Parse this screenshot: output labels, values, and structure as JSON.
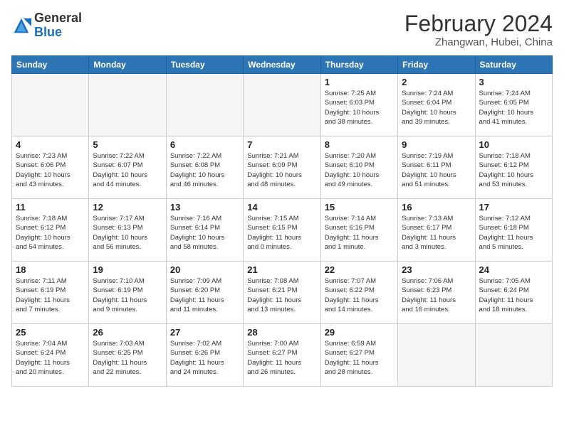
{
  "logo": {
    "general": "General",
    "blue": "Blue"
  },
  "header": {
    "month_year": "February 2024",
    "location": "Zhangwan, Hubei, China"
  },
  "days_of_week": [
    "Sunday",
    "Monday",
    "Tuesday",
    "Wednesday",
    "Thursday",
    "Friday",
    "Saturday"
  ],
  "weeks": [
    [
      {
        "day": "",
        "info": ""
      },
      {
        "day": "",
        "info": ""
      },
      {
        "day": "",
        "info": ""
      },
      {
        "day": "",
        "info": ""
      },
      {
        "day": "1",
        "info": "Sunrise: 7:25 AM\nSunset: 6:03 PM\nDaylight: 10 hours\nand 38 minutes."
      },
      {
        "day": "2",
        "info": "Sunrise: 7:24 AM\nSunset: 6:04 PM\nDaylight: 10 hours\nand 39 minutes."
      },
      {
        "day": "3",
        "info": "Sunrise: 7:24 AM\nSunset: 6:05 PM\nDaylight: 10 hours\nand 41 minutes."
      }
    ],
    [
      {
        "day": "4",
        "info": "Sunrise: 7:23 AM\nSunset: 6:06 PM\nDaylight: 10 hours\nand 43 minutes."
      },
      {
        "day": "5",
        "info": "Sunrise: 7:22 AM\nSunset: 6:07 PM\nDaylight: 10 hours\nand 44 minutes."
      },
      {
        "day": "6",
        "info": "Sunrise: 7:22 AM\nSunset: 6:08 PM\nDaylight: 10 hours\nand 46 minutes."
      },
      {
        "day": "7",
        "info": "Sunrise: 7:21 AM\nSunset: 6:09 PM\nDaylight: 10 hours\nand 48 minutes."
      },
      {
        "day": "8",
        "info": "Sunrise: 7:20 AM\nSunset: 6:10 PM\nDaylight: 10 hours\nand 49 minutes."
      },
      {
        "day": "9",
        "info": "Sunrise: 7:19 AM\nSunset: 6:11 PM\nDaylight: 10 hours\nand 51 minutes."
      },
      {
        "day": "10",
        "info": "Sunrise: 7:18 AM\nSunset: 6:12 PM\nDaylight: 10 hours\nand 53 minutes."
      }
    ],
    [
      {
        "day": "11",
        "info": "Sunrise: 7:18 AM\nSunset: 6:12 PM\nDaylight: 10 hours\nand 54 minutes."
      },
      {
        "day": "12",
        "info": "Sunrise: 7:17 AM\nSunset: 6:13 PM\nDaylight: 10 hours\nand 56 minutes."
      },
      {
        "day": "13",
        "info": "Sunrise: 7:16 AM\nSunset: 6:14 PM\nDaylight: 10 hours\nand 58 minutes."
      },
      {
        "day": "14",
        "info": "Sunrise: 7:15 AM\nSunset: 6:15 PM\nDaylight: 11 hours\nand 0 minutes."
      },
      {
        "day": "15",
        "info": "Sunrise: 7:14 AM\nSunset: 6:16 PM\nDaylight: 11 hours\nand 1 minute."
      },
      {
        "day": "16",
        "info": "Sunrise: 7:13 AM\nSunset: 6:17 PM\nDaylight: 11 hours\nand 3 minutes."
      },
      {
        "day": "17",
        "info": "Sunrise: 7:12 AM\nSunset: 6:18 PM\nDaylight: 11 hours\nand 5 minutes."
      }
    ],
    [
      {
        "day": "18",
        "info": "Sunrise: 7:11 AM\nSunset: 6:19 PM\nDaylight: 11 hours\nand 7 minutes."
      },
      {
        "day": "19",
        "info": "Sunrise: 7:10 AM\nSunset: 6:19 PM\nDaylight: 11 hours\nand 9 minutes."
      },
      {
        "day": "20",
        "info": "Sunrise: 7:09 AM\nSunset: 6:20 PM\nDaylight: 11 hours\nand 11 minutes."
      },
      {
        "day": "21",
        "info": "Sunrise: 7:08 AM\nSunset: 6:21 PM\nDaylight: 11 hours\nand 13 minutes."
      },
      {
        "day": "22",
        "info": "Sunrise: 7:07 AM\nSunset: 6:22 PM\nDaylight: 11 hours\nand 14 minutes."
      },
      {
        "day": "23",
        "info": "Sunrise: 7:06 AM\nSunset: 6:23 PM\nDaylight: 11 hours\nand 16 minutes."
      },
      {
        "day": "24",
        "info": "Sunrise: 7:05 AM\nSunset: 6:24 PM\nDaylight: 11 hours\nand 18 minutes."
      }
    ],
    [
      {
        "day": "25",
        "info": "Sunrise: 7:04 AM\nSunset: 6:24 PM\nDaylight: 11 hours\nand 20 minutes."
      },
      {
        "day": "26",
        "info": "Sunrise: 7:03 AM\nSunset: 6:25 PM\nDaylight: 11 hours\nand 22 minutes."
      },
      {
        "day": "27",
        "info": "Sunrise: 7:02 AM\nSunset: 6:26 PM\nDaylight: 11 hours\nand 24 minutes."
      },
      {
        "day": "28",
        "info": "Sunrise: 7:00 AM\nSunset: 6:27 PM\nDaylight: 11 hours\nand 26 minutes."
      },
      {
        "day": "29",
        "info": "Sunrise: 6:59 AM\nSunset: 6:27 PM\nDaylight: 11 hours\nand 28 minutes."
      },
      {
        "day": "",
        "info": ""
      },
      {
        "day": "",
        "info": ""
      }
    ]
  ]
}
